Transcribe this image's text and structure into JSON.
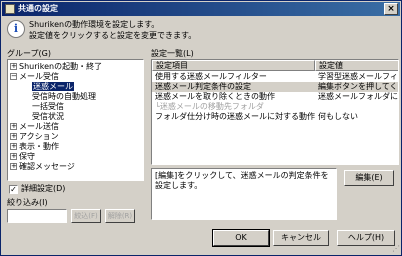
{
  "window": {
    "title": "共通の設定",
    "close_glyph": "×"
  },
  "info": {
    "icon": "info-icon",
    "line1": "Shurikenの動作環境を設定します。",
    "line2": "設定値をクリックすると設定を変更できます。"
  },
  "group": {
    "label": "グループ(G)",
    "tree": [
      {
        "label": "Shurikenの起動・終了",
        "toggle": "+"
      },
      {
        "label": "メール受信",
        "toggle": "−"
      },
      {
        "label": "迷惑メール",
        "selected": true
      },
      {
        "label": "受信時の自動処理"
      },
      {
        "label": "一括受信"
      },
      {
        "label": "受信状況"
      },
      {
        "label": "メール送信",
        "toggle": "+"
      },
      {
        "label": "アクション",
        "toggle": "+"
      },
      {
        "label": "表示・動作",
        "toggle": "+"
      },
      {
        "label": "保守",
        "toggle": "+"
      },
      {
        "label": "確認メッセージ",
        "toggle": "+"
      }
    ]
  },
  "details": {
    "label": "詳細設定(D)",
    "checked": true,
    "check_glyph": "✓"
  },
  "filter": {
    "label": "絞り込み(I)",
    "value": "",
    "find_label": "絞込(F)",
    "clear_label": "解除(R)"
  },
  "settings": {
    "label": "設定一覧(L)",
    "columns": [
      "設定項目",
      "設定値"
    ],
    "rows": [
      {
        "item": "使用する迷惑メールフィルター",
        "value": "学習型迷惑メールフィルター"
      },
      {
        "item": "迷惑メール判定条件の設定",
        "value": "編集ボタンを押してください",
        "selected": true
      },
      {
        "item": "迷惑メールを取り除くときの動作",
        "value": "迷惑メールフォルダに移動"
      },
      {
        "item": "└迷惑メールの移動先フォルダ",
        "value": "",
        "disabled": true
      },
      {
        "item": "フォルダ仕分け時の迷惑メールに対する動作",
        "value": "何もしない"
      }
    ]
  },
  "description": "[編集]をクリックして、迷惑メールの判定条件を設定します。",
  "buttons": {
    "edit": "編集(E)",
    "ok": "OK",
    "cancel": "キャンセル",
    "help": "ヘルプ(H)"
  }
}
